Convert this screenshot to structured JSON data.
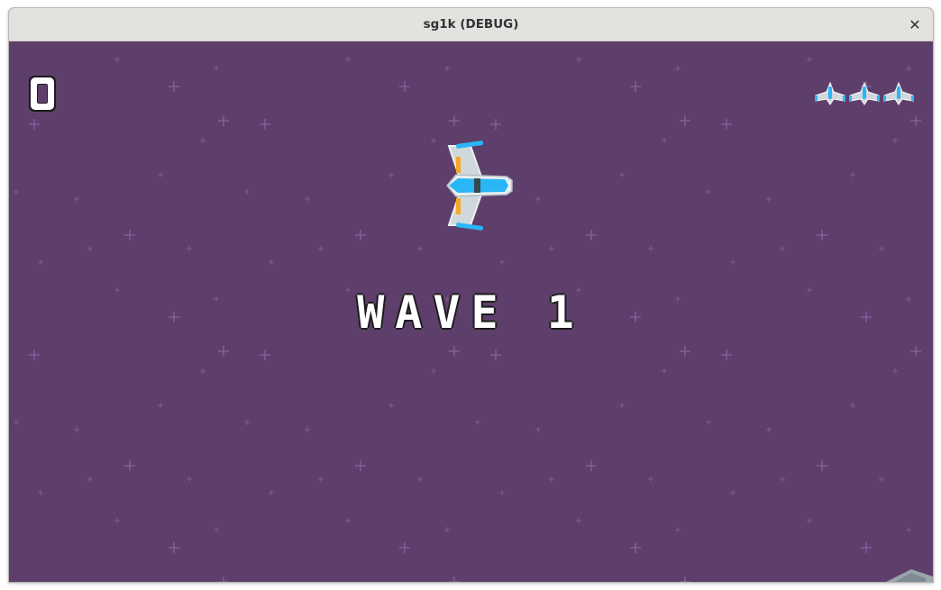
{
  "window": {
    "title": "sg1k (DEBUG)",
    "close_icon": "close-icon"
  },
  "hud": {
    "score": "0",
    "lives": 3,
    "life_icon": "ship-icon"
  },
  "banner": {
    "wave_text": "WAVE 1"
  },
  "colors": {
    "background": "#5e3f6b",
    "star": "#8f6fb0",
    "ship_body": "#cfd8dc",
    "ship_accent": "#29b6f6",
    "ship_flame": "#f9a825",
    "text": "#ffffff"
  }
}
